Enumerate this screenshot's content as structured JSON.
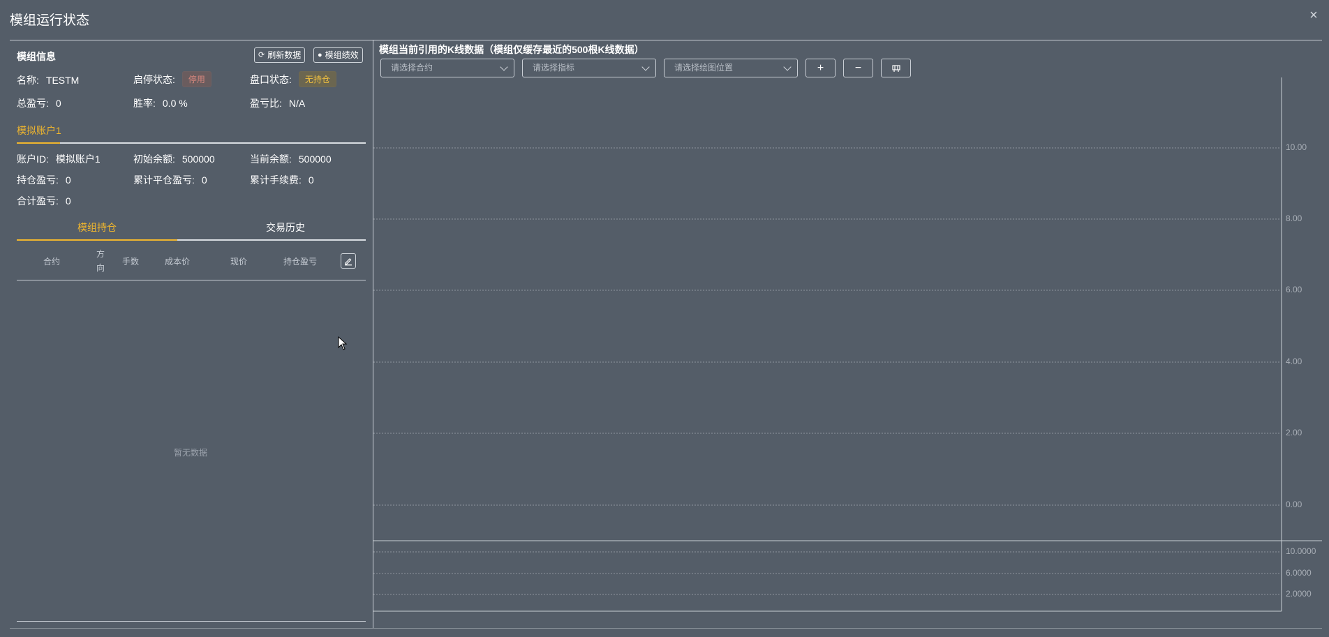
{
  "dialog": {
    "title": "模组运行状态",
    "close": "×"
  },
  "module_info": {
    "title": "模组信息",
    "refresh_label": "刷新数据",
    "performance_label": "模组绩效",
    "name_label": "名称:",
    "name_value": "TESTM",
    "run_state_label": "启停状态:",
    "run_state_value": "停用",
    "position_state_label": "盘口状态:",
    "position_state_value": "无持仓",
    "total_pnl_label": "总盈亏:",
    "total_pnl_value": "0",
    "win_rate_label": "胜率:",
    "win_rate_value": "0.0 %",
    "pnl_ratio_label": "盈亏比:",
    "pnl_ratio_value": "N/A"
  },
  "account": {
    "tab_label": "模拟账户1",
    "id_label": "账户ID:",
    "id_value": "模拟账户1",
    "init_balance_label": "初始余额:",
    "init_balance_value": "500000",
    "cur_balance_label": "当前余额:",
    "cur_balance_value": "500000",
    "holding_pnl_label": "持仓盈亏:",
    "holding_pnl_value": "0",
    "closed_pnl_label": "累计平仓盈亏:",
    "closed_pnl_value": "0",
    "fee_label": "累计手续费:",
    "fee_value": "0",
    "sum_pnl_label": "合计盈亏:",
    "sum_pnl_value": "0"
  },
  "position_tabs": {
    "positions": "模组持仓",
    "history": "交易历史"
  },
  "table": {
    "headers": [
      "合约",
      "方\n向",
      "手数",
      "成本价",
      "现价",
      "持仓盈亏"
    ],
    "dir_line1": "方",
    "dir_line2": "向",
    "empty": "暂无数据"
  },
  "chart": {
    "title": "模组当前引用的K线数据（模组仅缓存最近的500根K线数据）",
    "select_contract_placeholder": "请选择合约",
    "select_indicator_placeholder": "请选择指标",
    "select_position_placeholder": "请选择绘图位置",
    "zoom_in": "+",
    "zoom_out": "−",
    "main_ticks": [
      "10.00",
      "8.00",
      "6.00",
      "4.00",
      "2.00",
      "0.00"
    ],
    "sub_ticks": [
      "10.0000",
      "6.0000",
      "2.0000"
    ]
  },
  "colors": {
    "accent": "#f0b62e",
    "background": "#545d68",
    "stop_badge": "#d5867d"
  }
}
